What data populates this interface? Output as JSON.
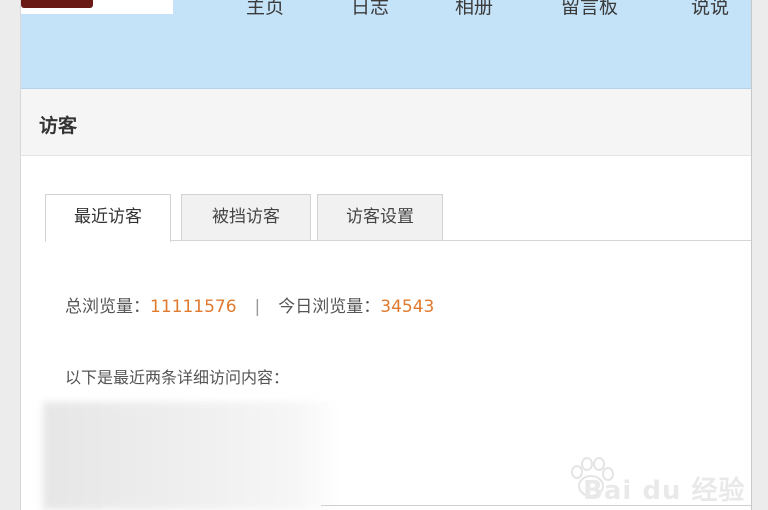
{
  "nav": {
    "items": [
      {
        "label": "主页"
      },
      {
        "label": "日志"
      },
      {
        "label": "相册"
      },
      {
        "label": "留言板"
      },
      {
        "label": "说说"
      }
    ]
  },
  "section": {
    "title": "访客"
  },
  "tabs": [
    {
      "label": "最近访客",
      "active": true
    },
    {
      "label": "被挡访客",
      "active": false
    },
    {
      "label": "访客设置",
      "active": false
    }
  ],
  "stats": {
    "total_label": "总浏览量：",
    "total_value": "11111576",
    "separator": "|",
    "today_label": "今日浏览量：",
    "today_value": "34543"
  },
  "detail_intro": "以下是最近两条详细访问内容：",
  "watermark": {
    "text": "Bai du 经验"
  },
  "colors": {
    "header_bg": "#c4e2f8",
    "count_color": "#e07a2e"
  }
}
